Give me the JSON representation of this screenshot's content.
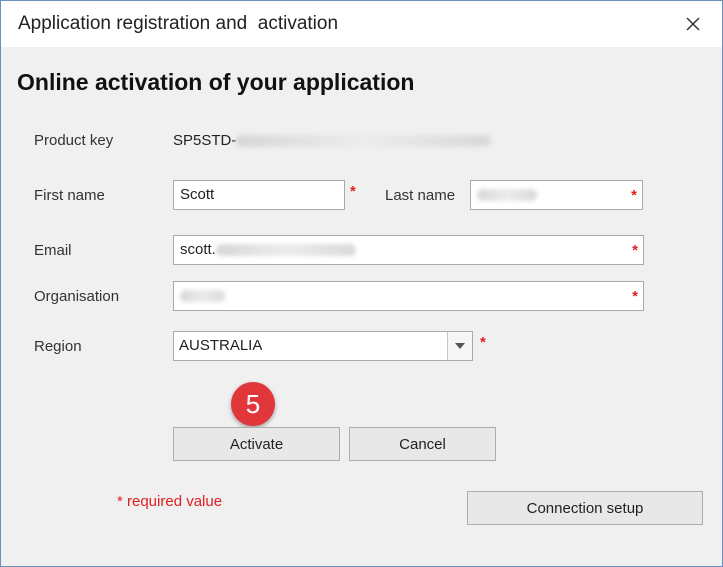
{
  "window": {
    "title": "Application registration and  activation"
  },
  "heading": "Online activation of your application",
  "form": {
    "product_key_label": "Product key",
    "product_key_value": "SP5STD-",
    "first_name_label": "First name",
    "first_name_value": "Scott",
    "last_name_label": "Last name",
    "last_name_value": "",
    "email_label": "Email",
    "email_value": "scott.",
    "organisation_label": "Organisation",
    "organisation_value": "",
    "region_label": "Region",
    "region_value": "AUSTRALIA",
    "required_marker": "*"
  },
  "buttons": {
    "activate": "Activate",
    "cancel": "Cancel",
    "connection_setup": "Connection setup"
  },
  "step_badge": "5",
  "required_note": "* required value",
  "colors": {
    "required": "#e02020",
    "badge": "#e2373a",
    "border": "#6e8fbf"
  },
  "icons": {
    "close": "close-icon",
    "dropdown": "chevron-down-icon"
  }
}
